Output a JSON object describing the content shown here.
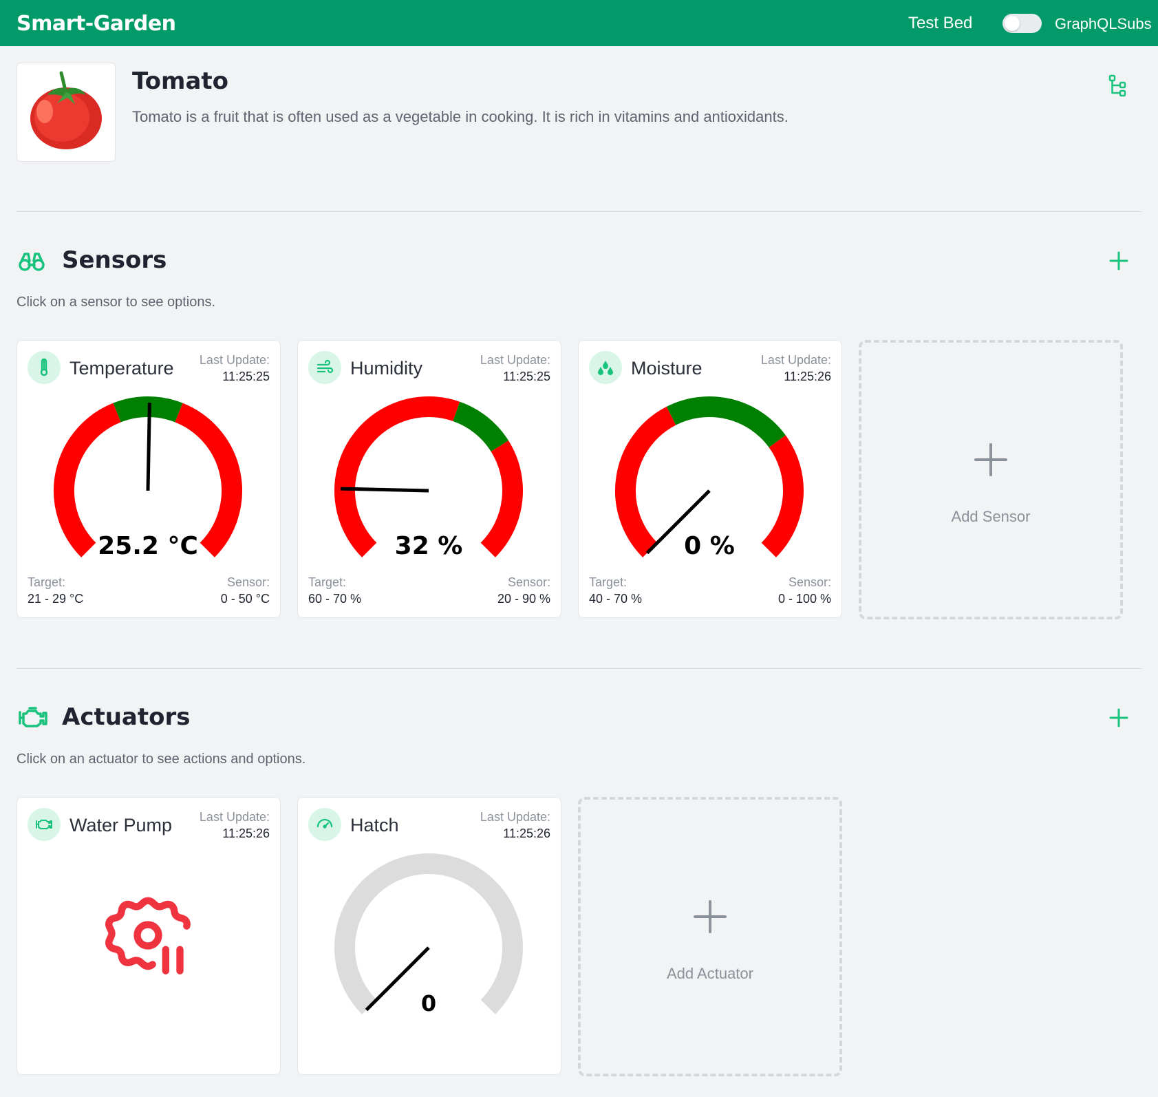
{
  "header": {
    "brand": "Smart-Garden",
    "bed_name": "Test Bed",
    "toggle_label": "GraphQLSubs",
    "toggle_on": false,
    "color": "#019a68"
  },
  "plant": {
    "name": "Tomato",
    "description": "Tomato is a fruit that is often used as a vegetable in cooking. It is rich in vitamins and antioxidants.",
    "image_icon": "tomato-image",
    "action_icon": "sitemap-icon"
  },
  "sensors_section": {
    "title": "Sensors",
    "icon": "binoculars-icon",
    "hint": "Click on a sensor to see options.",
    "add_icon": "plus-icon",
    "add_card_label": "Add Sensor"
  },
  "sensors": [
    {
      "name": "Temperature",
      "icon": "thermometer-icon",
      "last_update_label": "Last Update:",
      "last_update": "11:25:25",
      "reading": "25.2 °C",
      "value": 25.2,
      "min": 0,
      "max": 50,
      "target_min": 21,
      "target_max": 29,
      "target_label": "Target:",
      "target": "21 - 29 °C",
      "sensor_label": "Sensor:",
      "sensor_range": "0 - 50 °C"
    },
    {
      "name": "Humidity",
      "icon": "wind-icon",
      "last_update_label": "Last Update:",
      "last_update": "11:25:25",
      "reading": "32 %",
      "value": 32,
      "min": 20,
      "max": 90,
      "target_min": 60,
      "target_max": 70,
      "target_label": "Target:",
      "target": "60 - 70 %",
      "sensor_label": "Sensor:",
      "sensor_range": "20 - 90 %"
    },
    {
      "name": "Moisture",
      "icon": "droplets-icon",
      "last_update_label": "Last Update:",
      "last_update": "11:25:26",
      "reading": "0 %",
      "value": 0,
      "min": 0,
      "max": 100,
      "target_min": 40,
      "target_max": 70,
      "target_label": "Target:",
      "target": "40 - 70 %",
      "sensor_label": "Sensor:",
      "sensor_range": "0 - 100 %"
    }
  ],
  "actuators_section": {
    "title": "Actuators",
    "icon": "engine-icon",
    "hint": "Click on an actuator to see actions and options.",
    "add_icon": "plus-icon",
    "add_card_label": "Add Actuator"
  },
  "actuators": [
    {
      "name": "Water Pump",
      "icon": "engine-icon",
      "last_update_label": "Last Update:",
      "last_update": "11:25:26",
      "state_icon": "settings-pause-icon"
    },
    {
      "name": "Hatch",
      "icon": "gauge-icon",
      "last_update_label": "Last Update:",
      "last_update": "11:25:26",
      "reading": "0",
      "value": 0,
      "min": 0,
      "max": 100
    }
  ],
  "colors": {
    "accent": "#19c37d",
    "gauge_bad": "#ff0000",
    "gauge_good": "#008000",
    "gauge_idle": "#dcdcdc",
    "paused": "#f0343f"
  }
}
